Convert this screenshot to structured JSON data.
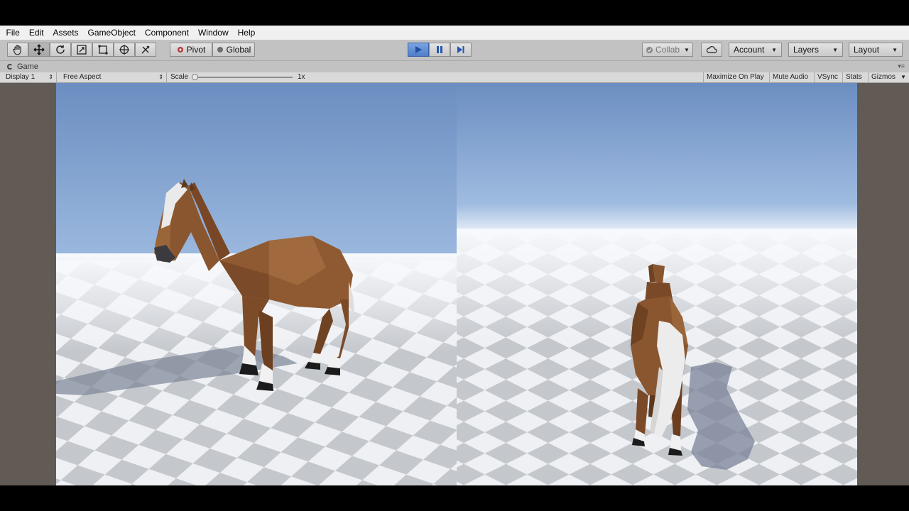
{
  "menu": {
    "items": [
      "File",
      "Edit",
      "Assets",
      "GameObject",
      "Component",
      "Window",
      "Help"
    ]
  },
  "toolbar": {
    "tools": [
      "hand-icon",
      "move-icon",
      "rotate-icon",
      "scale-icon",
      "rect-tool-icon",
      "transform-icon",
      "custom-tool-icon"
    ],
    "pivot_label": "Pivot",
    "global_label": "Global",
    "collab_label": "Collab",
    "account_label": "Account",
    "layers_label": "Layers",
    "layout_label": "Layout"
  },
  "tab": {
    "title": "Game"
  },
  "gamebar": {
    "display": "Display 1",
    "aspect": "Free Aspect",
    "scale_label": "Scale",
    "scale_value": "1x",
    "scale_level": 0.0,
    "maximize": "Maximize On Play",
    "mute": "Mute Audio",
    "vsync": "VSync",
    "stats": "Stats",
    "gizmos": "Gizmos"
  },
  "colors": {
    "play_active": "#4f7ec9",
    "horse_brown": "#8a5630",
    "sky_top": "#6b8ec1",
    "ground_light": "#f2f4f7",
    "ground_dark": "#c9ccd1"
  }
}
